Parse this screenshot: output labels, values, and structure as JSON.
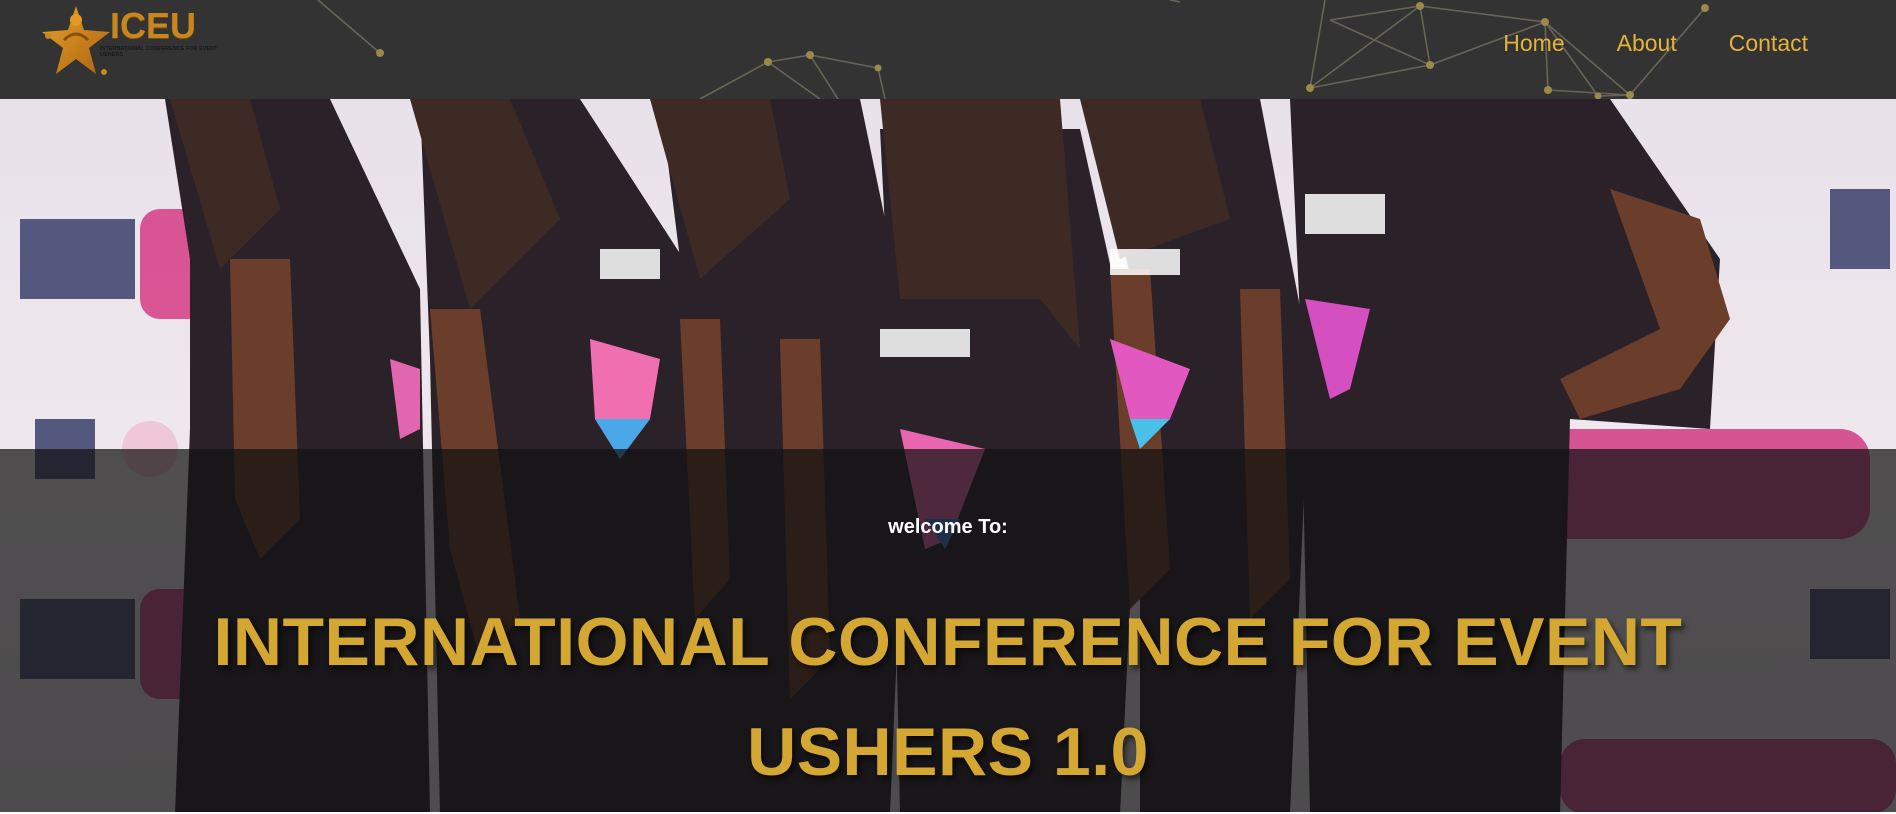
{
  "navbar": {
    "logo": {
      "text": "ICEU",
      "subtitle": "International Conference for Event Ushers"
    },
    "links": [
      "Home",
      "About",
      "Contact"
    ],
    "colors": {
      "background": "#333333",
      "link": "#e3b43a"
    }
  },
  "hero": {
    "welcome": "welcome To:",
    "title": "INTERNATIONAL CONFERENCE FOR EVENT USHERS 1.0",
    "colors": {
      "overlay": "rgba(18,18,18,0.72)",
      "title": "#d4a732",
      "welcome": "#ffffff"
    }
  }
}
